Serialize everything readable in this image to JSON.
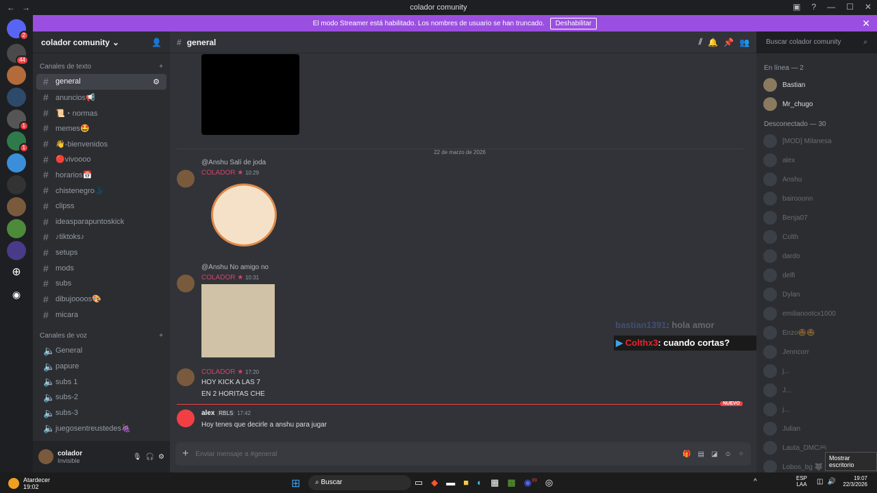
{
  "window": {
    "title": "colador comunity"
  },
  "banner": {
    "text": "El modo Streamer está habilitado. Los nombres de usuario se han truncado.",
    "button": "Deshabilitar"
  },
  "servers": {
    "badges": [
      "2",
      "44",
      "1",
      "1"
    ]
  },
  "guild": {
    "name": "colador comunity"
  },
  "categories": {
    "text": "Canales de texto",
    "voice": "Canales de voz"
  },
  "text_channels": [
    "general",
    "anuncios📢",
    "📜・normas",
    "memes🤩",
    "👋-bienvenidos",
    "🔴vivoooo",
    "horarios📅",
    "chistenegro🌑",
    "clipss",
    "ideasparapuntoskick",
    "♪tiktoks♪",
    "setups",
    "mods",
    "subs",
    "dibujoooos🎨",
    "micara"
  ],
  "voice_channels": [
    "General",
    "papure",
    "subs 1",
    "subs-2",
    "subs-3",
    "juegosentreustedes🍇"
  ],
  "user": {
    "name": "colador",
    "status": "Invisible"
  },
  "chat": {
    "channel": "general",
    "search_placeholder": "Buscar colador comunity",
    "date_divider": "22 de marzo de 2026",
    "messages": [
      {
        "reply": "@Anshu Salí de joda",
        "author": "COLADOR ★",
        "time": "10:29"
      },
      {
        "reply": "@Anshu No amigo no",
        "author": "COLADOR ★",
        "time": "10:31"
      },
      {
        "author": "COLADOR ★",
        "time": "17:20",
        "lines": [
          "HOY KICK A LAS 7",
          "EN 2 HORITAS CHE"
        ]
      },
      {
        "author": "alex",
        "tag": "RBLS",
        "time": "17:42",
        "lines": [
          "Hoy tenes que decirle a anshu para jugar"
        ]
      }
    ],
    "new_label": "NUEVO",
    "input_placeholder": "Enviar mensaje a #general"
  },
  "overlay": {
    "user1": "bastian1391",
    "text1": ": hola amor",
    "user2": "Colthx3",
    "text2": ": cuando cortas?"
  },
  "members": {
    "online_label": "En línea — 2",
    "online": [
      "Bastian",
      "Mr_chugo"
    ],
    "offline_label": "Desconectado — 30",
    "offline": [
      "[MOD] Milanesa",
      "alex",
      "Anshu",
      "bairooonn",
      "Benja07",
      "Colth",
      "dardo",
      "delfi",
      "Dylan",
      "emilianootcx1000",
      "Enzo🤩🤩",
      "Jenncorr",
      "j...",
      "J...",
      "j...",
      "Julian",
      "Lauta_DMC🎮",
      "Lobos_bg 🐺"
    ]
  },
  "tooltip": "Mostrar escritorio",
  "taskbar": {
    "weather": "Atardecer",
    "weather_time": "19:02",
    "search": "Buscar",
    "lang1": "ESP",
    "lang2": "LAA",
    "time": "19:07",
    "date": "22/3/2026",
    "discord_badge": "99"
  }
}
